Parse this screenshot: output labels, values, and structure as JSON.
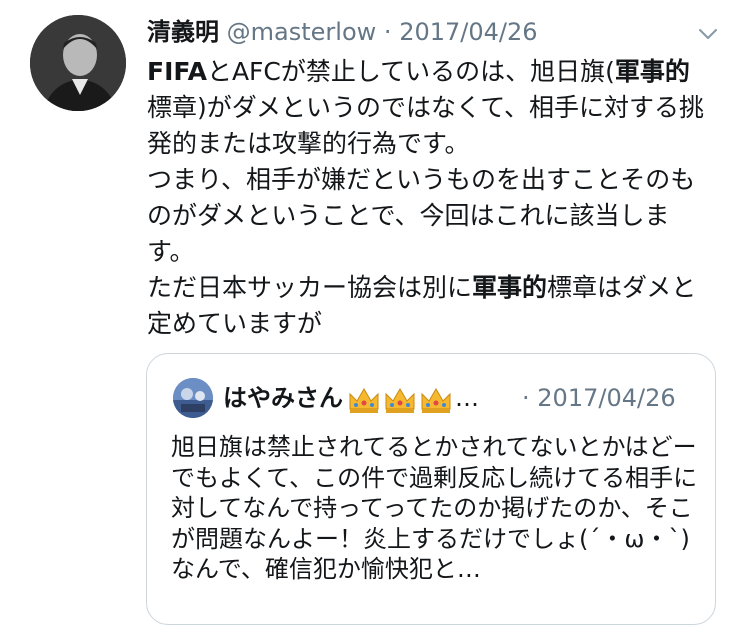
{
  "tweet": {
    "display_name": "清義明",
    "handle": "@masterlow",
    "separator": "·",
    "date": "2017/04/26",
    "more_icon": "chevron-down-icon",
    "text_segments": [
      {
        "text": "FIFA",
        "bold": true
      },
      {
        "text": "とAFCが禁止しているのは、旭日旗(",
        "bold": false
      },
      {
        "text": "軍事的",
        "bold": true
      },
      {
        "text": "標章)がダメというのではなくて、相手に対する挑発的または攻撃的行為です。\nつまり、相手が嫌だというものを出すことそのものがダメということで、今回はこれに該当します。\nただ日本サッカー協会は別に",
        "bold": false
      },
      {
        "text": "軍事的",
        "bold": true
      },
      {
        "text": "標章はダメと定めていますが",
        "bold": false
      }
    ]
  },
  "quoted_tweet": {
    "display_name": "はやみさん",
    "crowns_icon": "crown-icon",
    "ellipsis": "…",
    "separator": "·",
    "date": "2017/04/26",
    "text": "旭日旗は禁止されてるとかされてないとかはどーでもよくて、この件で過剰反応し続けてる相手に対してなんで持ってってたのか掲げたのか、そこが問題なんよー！炎上するだけでしょ(´・ω・`)なんで、確信犯か愉快犯と…"
  },
  "colors": {
    "text": "#14171a",
    "secondary": "#657786",
    "border": "#ccd6dd"
  }
}
